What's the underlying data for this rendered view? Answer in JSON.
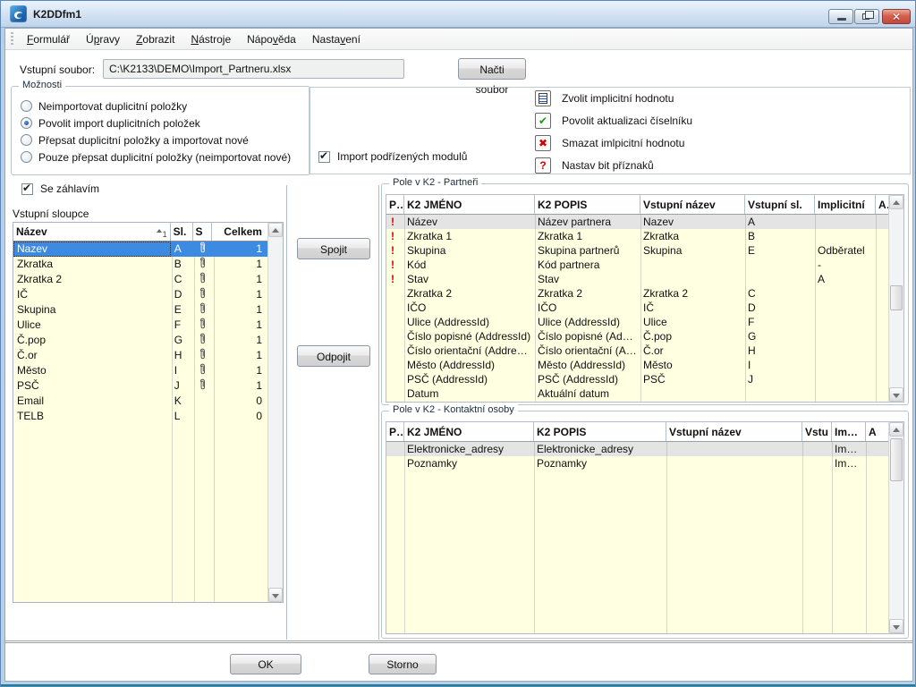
{
  "window": {
    "title": "K2DDfm1"
  },
  "menu": {
    "items": [
      {
        "label": "Formulář",
        "underline": 0
      },
      {
        "label": "Úpravy",
        "underline": 1
      },
      {
        "label": "Zobrazit",
        "underline": 0
      },
      {
        "label": "Nástroje",
        "underline": 0
      },
      {
        "label": "Nápověda",
        "underline": 4
      },
      {
        "label": "Nastavení",
        "underline": 5
      }
    ]
  },
  "file_row": {
    "label": "Vstupní soubor:",
    "value": "C:\\K2133\\DEMO\\Import_Partneru.xlsx",
    "button": "Načti soubor"
  },
  "options": {
    "title": "Možnosti",
    "radios": [
      {
        "label": "Neimportovat duplicitní položky",
        "selected": false
      },
      {
        "label": "Povolit import duplicitních položek",
        "selected": true
      },
      {
        "label": "Přepsat duplicitní položky a importovat nové",
        "selected": false
      },
      {
        "label": "Pouze přepsat duplicitní položky (neimportovat nové)",
        "selected": false
      }
    ]
  },
  "import_checkbox": {
    "label": "Import podřízených modulů",
    "checked": true
  },
  "legend": {
    "items": [
      {
        "icon": "document-icon",
        "label": "Zvolit implicitní hodnotu"
      },
      {
        "icon": "check-icon",
        "label": "Povolit aktualizaci číselníku"
      },
      {
        "icon": "delete-icon",
        "label": "Smazat imlpicitní hodnotu"
      },
      {
        "icon": "question-icon",
        "label": "Nastav bit příznaků"
      }
    ]
  },
  "header_checkbox": {
    "label": "Se záhlavím",
    "checked": true
  },
  "input_columns": {
    "title": "Vstupní sloupce",
    "sort_marker": "1",
    "columns": [
      "Název",
      "Sl.",
      "S",
      "Celkem"
    ],
    "rows": [
      {
        "name": "Nazev",
        "col": "A",
        "attach": true,
        "total": "1",
        "selected": true
      },
      {
        "name": "Zkratka",
        "col": "B",
        "attach": true,
        "total": "1",
        "selected": false
      },
      {
        "name": "Zkratka 2",
        "col": "C",
        "attach": true,
        "total": "1",
        "selected": false
      },
      {
        "name": "IČ",
        "col": "D",
        "attach": true,
        "total": "1",
        "selected": false
      },
      {
        "name": "Skupina",
        "col": "E",
        "attach": true,
        "total": "1",
        "selected": false
      },
      {
        "name": "Ulice",
        "col": "F",
        "attach": true,
        "total": "1",
        "selected": false
      },
      {
        "name": "Č.pop",
        "col": "G",
        "attach": true,
        "total": "1",
        "selected": false
      },
      {
        "name": "Č.or",
        "col": "H",
        "attach": true,
        "total": "1",
        "selected": false
      },
      {
        "name": "Město",
        "col": "I",
        "attach": true,
        "total": "1",
        "selected": false
      },
      {
        "name": "PSČ",
        "col": "J",
        "attach": true,
        "total": "1",
        "selected": false
      },
      {
        "name": "Email",
        "col": "K",
        "attach": false,
        "total": "0",
        "selected": false
      },
      {
        "name": "TELB",
        "col": "L",
        "attach": false,
        "total": "0",
        "selected": false
      }
    ]
  },
  "actions": {
    "join": "Spojit",
    "detach": "Odpojit"
  },
  "partners_table": {
    "title": "Pole v K2 - Partneři",
    "columns": [
      "PP",
      "K2 JMÉNO",
      "K2 POPIS",
      "Vstupní název",
      "Vstupní sl.",
      "Implicitní",
      "A"
    ],
    "rows": [
      {
        "pp": "!",
        "name": "Název",
        "desc": "Název partnera",
        "input_name": "Nazev",
        "input_col": "A",
        "implicit": "",
        "a": "",
        "selected": true
      },
      {
        "pp": "!",
        "name": "Zkratka 1",
        "desc": "Zkratka 1",
        "input_name": "Zkratka",
        "input_col": "B",
        "implicit": "",
        "a": "",
        "selected": false
      },
      {
        "pp": "!",
        "name": "Skupina",
        "desc": "Skupina partnerů",
        "input_name": "Skupina",
        "input_col": "E",
        "implicit": "Odběratel",
        "a": "",
        "selected": false
      },
      {
        "pp": "!",
        "name": "Kód",
        "desc": "Kód partnera",
        "input_name": "",
        "input_col": "",
        "implicit": "-",
        "a": "",
        "selected": false
      },
      {
        "pp": "!",
        "name": "Stav",
        "desc": "Stav",
        "input_name": "",
        "input_col": "",
        "implicit": "A",
        "a": "",
        "selected": false
      },
      {
        "pp": "",
        "name": "Zkratka 2",
        "desc": "Zkratka 2",
        "input_name": "Zkratka 2",
        "input_col": "C",
        "implicit": "",
        "a": "",
        "selected": false
      },
      {
        "pp": "",
        "name": "IČO",
        "desc": "IČO",
        "input_name": "IČ",
        "input_col": "D",
        "implicit": "",
        "a": "",
        "selected": false
      },
      {
        "pp": "",
        "name": "Ulice (AddressId)",
        "desc": "Ulice (AddressId)",
        "input_name": "Ulice",
        "input_col": "F",
        "implicit": "",
        "a": "",
        "selected": false
      },
      {
        "pp": "",
        "name": "Číslo popisné (AddressId)",
        "desc": "Číslo popisné (AddressId)",
        "input_name": "Č.pop",
        "input_col": "G",
        "implicit": "",
        "a": "",
        "selected": false
      },
      {
        "pp": "",
        "name": "Číslo orientační (AddressId)",
        "desc": "Číslo orientační (AddressId)",
        "input_name": "Č.or",
        "input_col": "H",
        "implicit": "",
        "a": "",
        "selected": false
      },
      {
        "pp": "",
        "name": "Město (AddressId)",
        "desc": "Město (AddressId)",
        "input_name": "Město",
        "input_col": "I",
        "implicit": "",
        "a": "",
        "selected": false
      },
      {
        "pp": "",
        "name": "PSČ (AddressId)",
        "desc": "PSČ (AddressId)",
        "input_name": "PSČ",
        "input_col": "J",
        "implicit": "",
        "a": "",
        "selected": false
      },
      {
        "pp": "",
        "name": "Datum",
        "desc": "Aktuální datum",
        "input_name": "",
        "input_col": "",
        "implicit": "",
        "a": "",
        "selected": false
      }
    ]
  },
  "contacts_table": {
    "title": "Pole v K2 - Kontaktní osoby",
    "columns": [
      "PP",
      "K2 JMÉNO",
      "K2 POPIS",
      "Vstupní název",
      "Vstu",
      "Implici",
      "A"
    ],
    "rows": [
      {
        "pp": "",
        "name": "Elektronicke_adresy",
        "desc": "Elektronicke_adresy",
        "input_name": "",
        "input_col": "",
        "implicit": "Impo...",
        "a": "",
        "selected": true
      },
      {
        "pp": "",
        "name": "Poznamky",
        "desc": "Poznamky",
        "input_name": "",
        "input_col": "",
        "implicit": "Impo...",
        "a": "",
        "selected": false
      }
    ]
  },
  "footer": {
    "ok": "OK",
    "cancel": "Storno"
  },
  "colors": {
    "selection_blue": "#3d8ae2",
    "grid_yellow": "#ffffe1",
    "alert_red": "#d40000",
    "selected_row_gray": "#e4e4e4",
    "titlebar_blue": "#bfd4ea"
  }
}
